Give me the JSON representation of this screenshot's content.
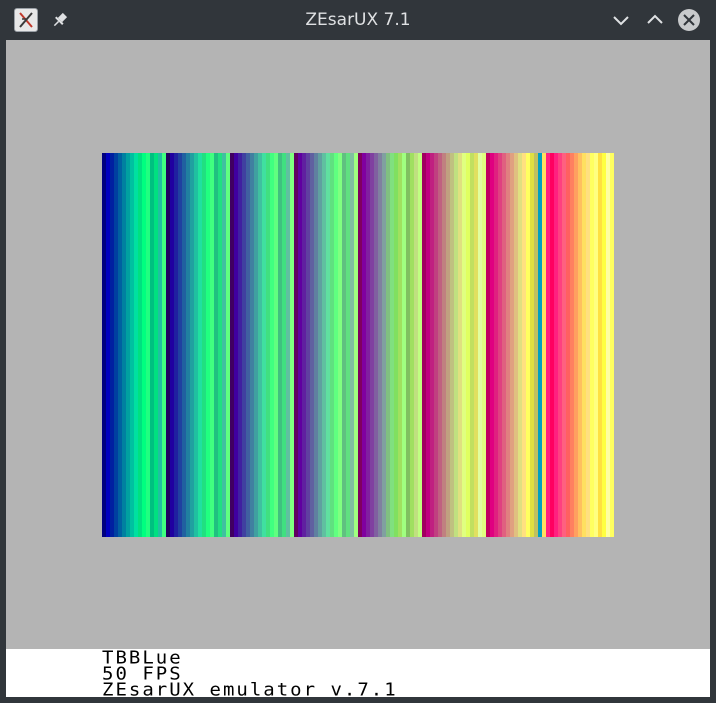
{
  "window": {
    "title": "ZEsarUX 7.1"
  },
  "titlebar_icons": [
    "app-icon",
    "pin-icon",
    "minimize-icon",
    "maximize-icon",
    "close-icon"
  ],
  "footer": {
    "lines": [
      "TBBLue",
      "50 FPS",
      "ZEsarUX emulator v.7.1"
    ]
  },
  "colors": {
    "titlebar": "#31363b",
    "title_text": "#dfe1e3",
    "border_area": "#b4b4b4",
    "footer_bg": "#ffffff",
    "close_button": "#c8cacc"
  },
  "color_bars": {
    "description_groups": 8,
    "groups": [
      [
        "#000080",
        "#0000c0",
        "#0020a0",
        "#0040a0",
        "#0060a0",
        "#0080a0",
        "#00a0a0",
        "#00c0a0",
        "#00e0a0",
        "#00e080",
        "#00ff80",
        "#20ff80",
        "#00c080",
        "#00e080",
        "#20c0a0",
        "#40ff80"
      ],
      [
        "#200060",
        "#2000a0",
        "#2020a0",
        "#2040a0",
        "#2060a0",
        "#2080a0",
        "#20a0a0",
        "#20c0a0",
        "#20e0a0",
        "#20e080",
        "#20ff80",
        "#40ff80",
        "#20c080",
        "#20e080",
        "#40c0a0",
        "#60ff80"
      ],
      [
        "#400060",
        "#4000a0",
        "#4020a0",
        "#4040a0",
        "#4060a0",
        "#4080a0",
        "#40a0a0",
        "#40c0a0",
        "#40e0a0",
        "#40e080",
        "#40ff80",
        "#60ff80",
        "#40c080",
        "#40e080",
        "#60c0a0",
        "#80ff80"
      ],
      [
        "#600060",
        "#6000a0",
        "#6020a0",
        "#6040a0",
        "#6060a0",
        "#6080a0",
        "#60a0a0",
        "#60c0a0",
        "#60e0a0",
        "#60e080",
        "#60ff80",
        "#80ff80",
        "#60c080",
        "#60e080",
        "#80c0a0",
        "#a0ff80"
      ],
      [
        "#800060",
        "#8000a0",
        "#8020a0",
        "#8040a0",
        "#8060a0",
        "#8080a0",
        "#80a0a0",
        "#80c080",
        "#80e080",
        "#80e060",
        "#a0e060",
        "#a0ff80",
        "#80c060",
        "#a0e060",
        "#c0e080",
        "#c0ff80"
      ],
      [
        "#a00060",
        "#c00080",
        "#c02080",
        "#c04080",
        "#c06080",
        "#c08080",
        "#c0a080",
        "#c0c080",
        "#c0e080",
        "#e0e080",
        "#e0ff80",
        "#e0ff60",
        "#c0e060",
        "#e0e060",
        "#e0ffa0",
        "#e0ff80"
      ],
      [
        "#c00060",
        "#e00080",
        "#e02080",
        "#e04080",
        "#e06080",
        "#e08080",
        "#e0a080",
        "#e0c080",
        "#e0e080",
        "#ffe080",
        "#ffff60",
        "#e0e040",
        "#c0c060",
        "#00a0c0",
        "#ffe060",
        "#ff2080"
      ],
      [
        "#ff0060",
        "#ff2080",
        "#ff4080",
        "#ff6080",
        "#ff6060",
        "#ff8060",
        "#ffa060",
        "#ffc060",
        "#ffe060",
        "#ffe080",
        "#ffff60",
        "#ffff80",
        "#ffe040",
        "#ffff40",
        "#ffffa0",
        "#ffff60"
      ]
    ]
  }
}
